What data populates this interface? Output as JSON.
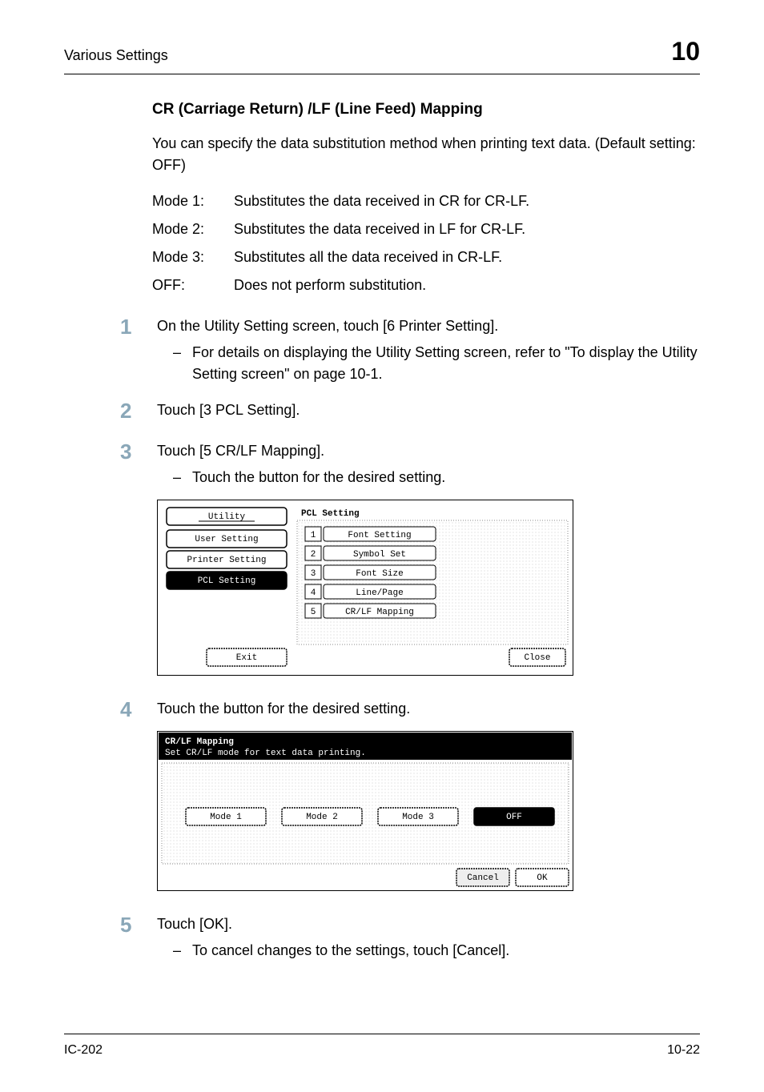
{
  "header": {
    "left": "Various Settings",
    "right": "10"
  },
  "section_title": "CR (Carriage Return) /LF (Line Feed) Mapping",
  "intro": "You can specify the data substitution method when printing text data. (Default setting: OFF)",
  "modes": [
    {
      "label": "Mode 1:",
      "desc": "Substitutes the data received in CR for CR-LF."
    },
    {
      "label": "Mode 2:",
      "desc": "Substitutes the data received in LF for CR-LF."
    },
    {
      "label": "Mode 3:",
      "desc": "Substitutes all the data received in CR-LF."
    },
    {
      "label": "OFF:",
      "desc": "Does not perform substitution."
    }
  ],
  "steps": {
    "s1": {
      "num": "1",
      "text": "On the Utility Setting screen, touch [6 Printer Setting].",
      "sub": "For details on displaying the Utility Setting screen, refer to \"To display the Utility Setting screen\" on page 10-1."
    },
    "s2": {
      "num": "2",
      "text": "Touch [3 PCL Setting]."
    },
    "s3": {
      "num": "3",
      "text": "Touch [5 CR/LF Mapping].",
      "sub": "Touch the button for the desired setting."
    },
    "s4": {
      "num": "4",
      "text": "Touch the button for the desired setting."
    },
    "s5": {
      "num": "5",
      "text": "Touch [OK].",
      "sub": "To cancel changes to the settings, touch [Cancel]."
    }
  },
  "shot1": {
    "title": "PCL Setting",
    "tabs": {
      "utility": "Utility",
      "user": "User Setting",
      "printer": "Printer Setting",
      "pcl": "PCL Setting"
    },
    "items": {
      "i1": "Font Setting",
      "i2": "Symbol Set",
      "i3": "Font Size",
      "i4": "Line/Page",
      "i5": "CR/LF Mapping"
    },
    "buttons": {
      "exit": "Exit",
      "close": "Close"
    }
  },
  "shot2": {
    "title": "CR/LF Mapping",
    "subtitle": "Set CR/LF mode for text data printing.",
    "options": {
      "m1": "Mode 1",
      "m2": "Mode 2",
      "m3": "Mode 3",
      "off": "OFF"
    },
    "buttons": {
      "cancel": "Cancel",
      "ok": "OK"
    }
  },
  "footer": {
    "left": "IC-202",
    "right": "10-22"
  }
}
